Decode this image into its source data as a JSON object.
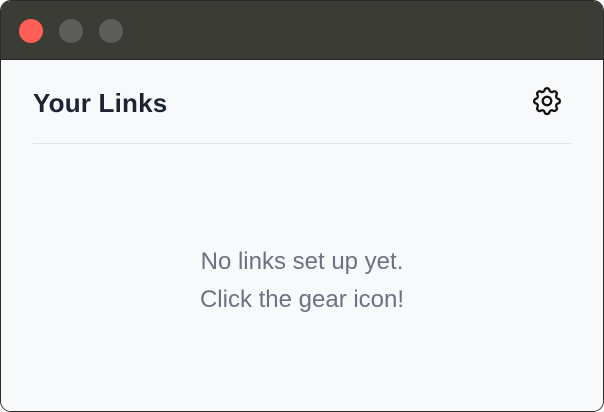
{
  "window": {
    "controls": [
      "close",
      "minimize",
      "maximize"
    ]
  },
  "header": {
    "title": "Your Links",
    "settings_icon": "gear-icon"
  },
  "empty_state": {
    "line1": "No links set up yet.",
    "line2": "Click the gear icon!"
  },
  "colors": {
    "titlebar": "#3c3c37",
    "close": "#fe5f57",
    "inactive_control": "#5d5d59",
    "background": "#f8f9fb",
    "title_text": "#1c2433",
    "muted_text": "#6b7280",
    "divider": "#e1e3e7"
  }
}
